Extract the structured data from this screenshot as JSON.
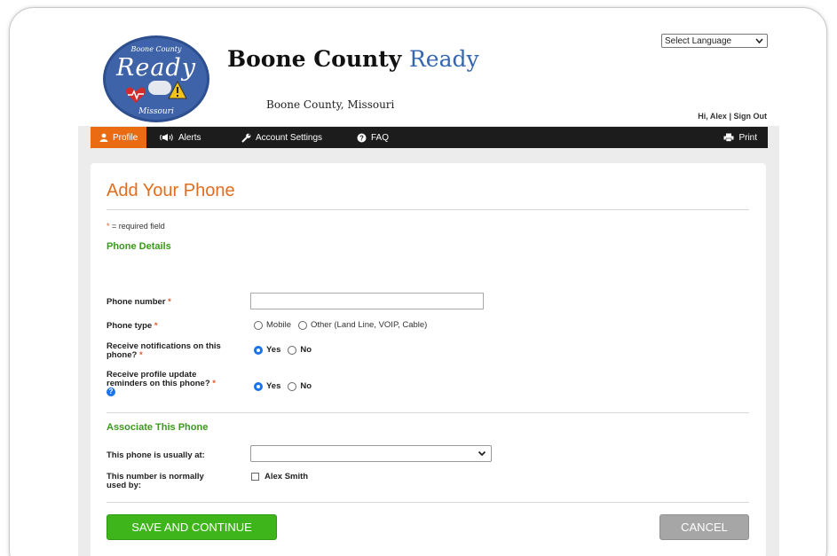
{
  "header": {
    "logo": {
      "top_text": "Boone County",
      "main_text": "Ready",
      "bottom_text": "Missouri"
    },
    "title_part1": "Boone County",
    "title_part2": "Ready",
    "subtitle": "Boone County, Missouri",
    "language_select": "Select Language",
    "user_greeting": "Hi, Alex",
    "separator": "|",
    "sign_out": "Sign Out"
  },
  "nav": {
    "items": [
      {
        "label": "Profile",
        "icon": "person-icon",
        "active": true
      },
      {
        "label": "Alerts",
        "icon": "megaphone-icon",
        "active": false
      },
      {
        "label": "Account Settings",
        "icon": "wrench-icon",
        "active": false
      },
      {
        "label": "FAQ",
        "icon": "question-icon",
        "active": false
      }
    ],
    "print_label": "Print",
    "print_icon": "printer-icon"
  },
  "form": {
    "title": "Add Your Phone",
    "required_star": "*",
    "required_note": " = required field",
    "phone_details_title": "Phone Details",
    "phone_number_label": "Phone number",
    "phone_number_value": "",
    "phone_type_label": "Phone type",
    "phone_type_options": [
      "Mobile",
      "Other (Land Line, VOIP, Cable)"
    ],
    "notifications_label_line1": "Receive notifications on this",
    "notifications_label_line2": "phone?",
    "notifications_options": [
      "Yes",
      "No"
    ],
    "notifications_selected": "Yes",
    "reminders_label_line1": "Receive profile update",
    "reminders_label_line2": "reminders on this phone?",
    "reminders_options": [
      "Yes",
      "No"
    ],
    "reminders_selected": "Yes",
    "help_icon_text": "?",
    "associate_title": "Associate This Phone",
    "location_label": "This phone is usually at:",
    "location_value": "",
    "used_by_label_line1": "This number is normally",
    "used_by_label_line2": "used by:",
    "used_by_option": "Alex Smith",
    "save_button": "SAVE AND CONTINUE",
    "cancel_button": "CANCEL"
  },
  "colors": {
    "accent_orange": "#e26d1f",
    "nav_active": "#ea6b11",
    "section_green": "#3a9a1a",
    "save_green": "#3fb51c",
    "cancel_gray": "#a6a6a6",
    "radio_blue": "#1a73e8",
    "brand_blue": "#3566b0"
  }
}
